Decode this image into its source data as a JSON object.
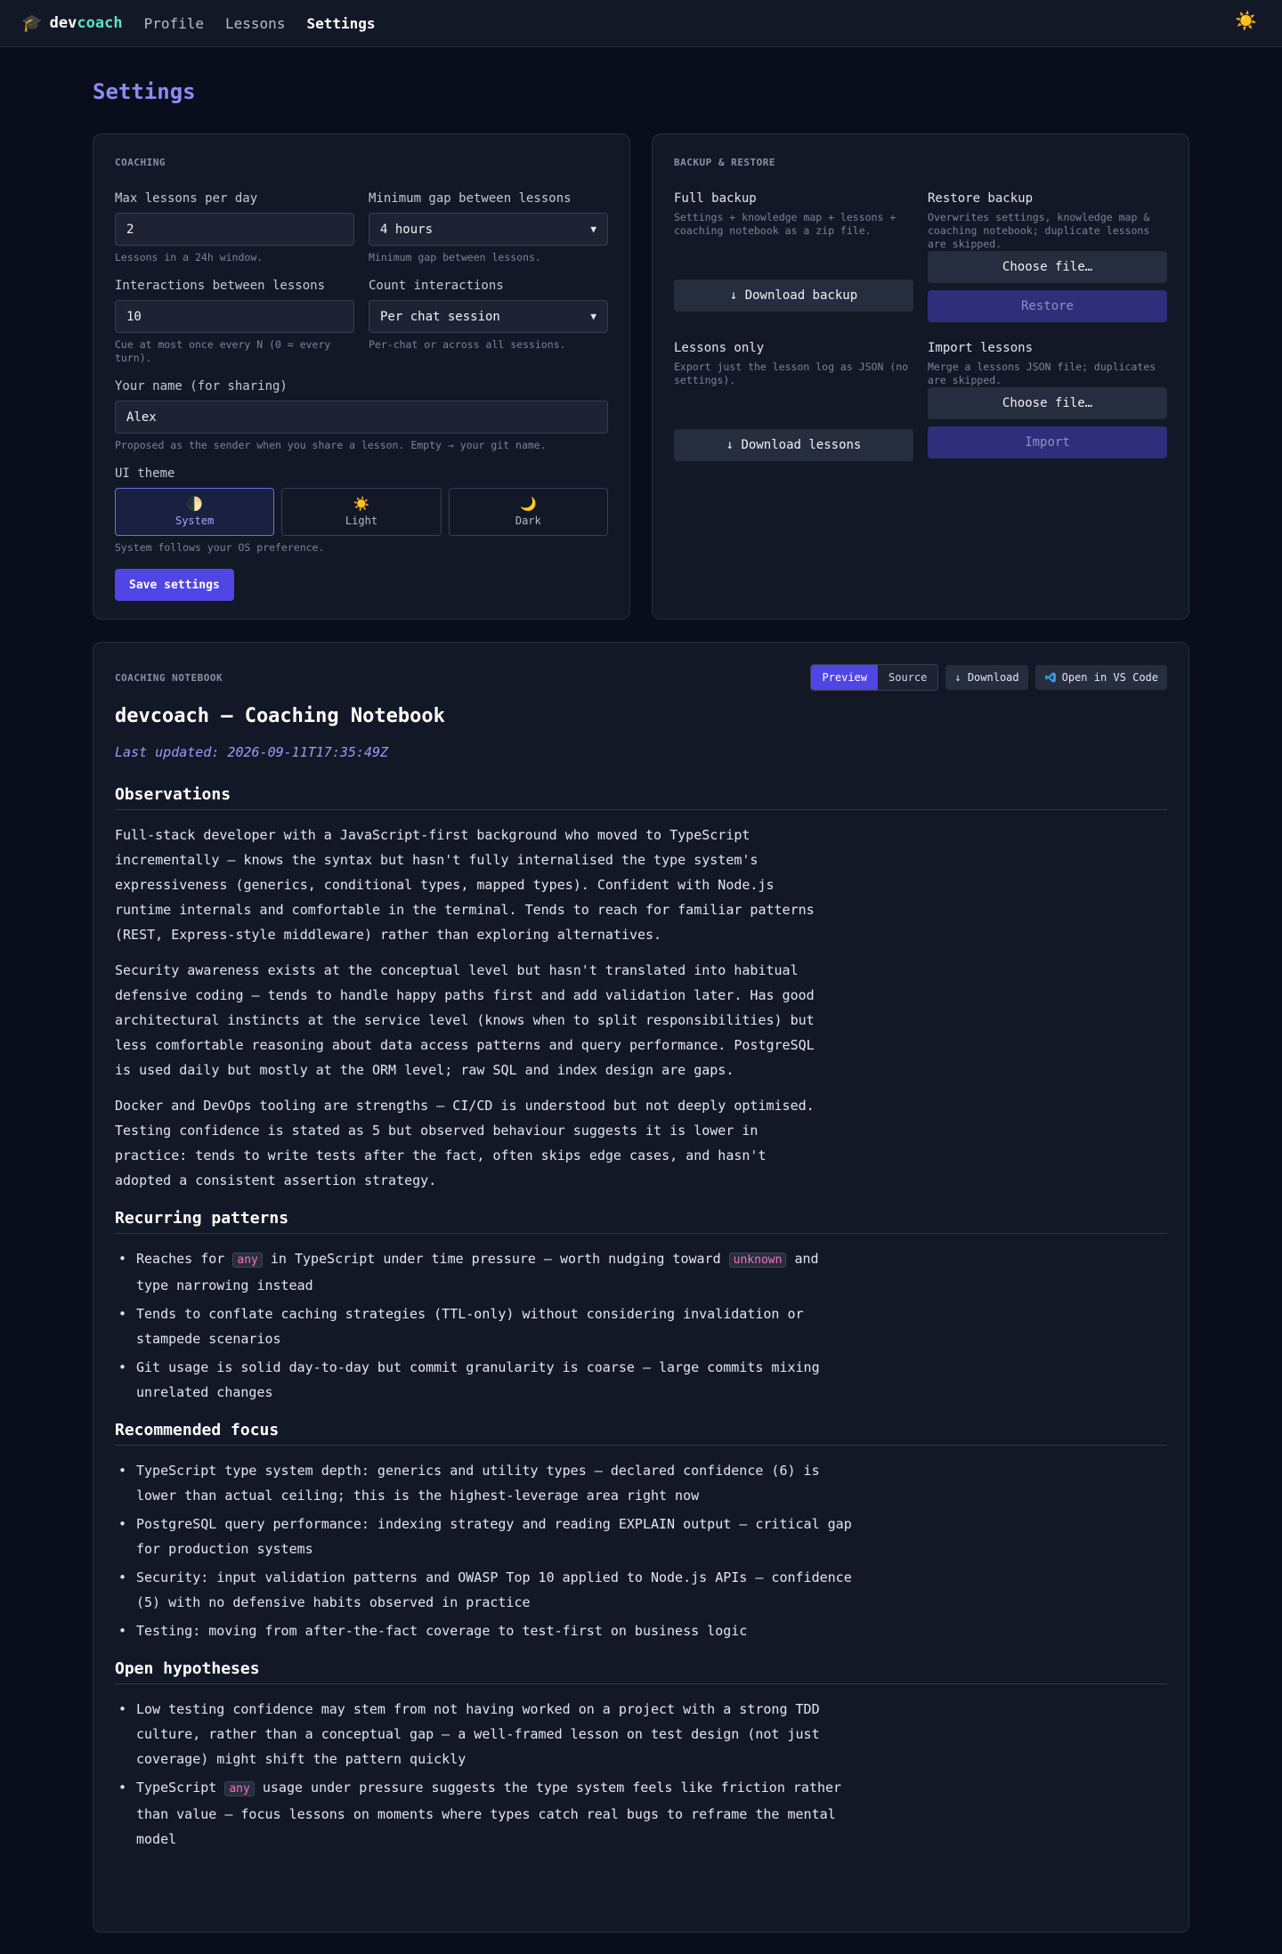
{
  "nav": {
    "brand_prefix": "dev",
    "brand_suffix": "coach",
    "links": [
      "Profile",
      "Lessons",
      "Settings"
    ],
    "active": "Settings"
  },
  "page": {
    "title": "Settings"
  },
  "coaching": {
    "label": "COACHING",
    "max_lessons": {
      "label": "Max lessons per day",
      "value": "2",
      "hint": "Lessons in a 24h window."
    },
    "min_gap": {
      "label": "Minimum gap between lessons",
      "value": "4 hours",
      "hint": "Minimum gap between lessons."
    },
    "interactions": {
      "label": "Interactions between lessons",
      "value": "10",
      "hint": "Cue at most once every N (0 = every turn)."
    },
    "count": {
      "label": "Count interactions",
      "value": "Per chat session",
      "hint": "Per-chat or across all sessions."
    },
    "name": {
      "label": "Your name (for sharing)",
      "value": "Alex",
      "hint": "Proposed as the sender when you share a lesson. Empty → your git name."
    },
    "theme": {
      "label": "UI theme",
      "options": [
        "System",
        "Light",
        "Dark"
      ],
      "selected": "System",
      "hint": "System follows your OS preference."
    },
    "save_label": "Save settings"
  },
  "backup": {
    "label": "BACKUP & RESTORE",
    "full": {
      "title": "Full backup",
      "desc": "Settings + knowledge map + lessons + coaching notebook as a zip file.",
      "button": "↓ Download backup"
    },
    "restore": {
      "title": "Restore backup",
      "desc": "Overwrites settings, knowledge map & coaching notebook; duplicate lessons are skipped.",
      "choose": "Choose file…",
      "button": "Restore"
    },
    "lessons": {
      "title": "Lessons only",
      "desc": "Export just the lesson log as JSON (no settings).",
      "button": "↓ Download lessons"
    },
    "import": {
      "title": "Import lessons",
      "desc": "Merge a lessons JSON file; duplicates are skipped.",
      "choose": "Choose file…",
      "button": "Import"
    }
  },
  "notebook": {
    "label": "COACHING NOTEBOOK",
    "tabs": [
      "Preview",
      "Source"
    ],
    "active_tab": "Preview",
    "download": "↓ Download",
    "vscode": "Open in VS Code",
    "title": "devcoach — Coaching Notebook",
    "updated": "Last updated: 2026-09-11T17:35:49Z",
    "observations": {
      "heading": "Observations",
      "paragraphs": [
        "Full-stack developer with a JavaScript-first background who moved to TypeScript incrementally — knows the syntax but hasn't fully internalised the type system's expressiveness (generics, conditional types, mapped types). Confident with Node.js runtime internals and comfortable in the terminal. Tends to reach for familiar patterns (REST, Express-style middleware) rather than exploring alternatives.",
        "Security awareness exists at the conceptual level but hasn't translated into habitual defensive coding — tends to handle happy paths first and add validation later. Has good architectural instincts at the service level (knows when to split responsibilities) but less comfortable reasoning about data access patterns and query performance. PostgreSQL is used daily but mostly at the ORM level; raw SQL and index design are gaps.",
        "Docker and DevOps tooling are strengths — CI/CD is understood but not deeply optimised. Testing confidence is stated as 5 but observed behaviour suggests it is lower in practice: tends to write tests after the fact, often skips edge cases, and hasn't adopted a consistent assertion strategy."
      ]
    },
    "patterns": {
      "heading": "Recurring patterns",
      "item1_a": "Reaches for ",
      "item1_code1": "any",
      "item1_b": " in TypeScript under time pressure — worth nudging toward ",
      "item1_code2": "unknown",
      "item1_c": " and type narrowing instead",
      "item2": "Tends to conflate caching strategies (TTL-only) without considering invalidation or stampede scenarios",
      "item3": "Git usage is solid day-to-day but commit granularity is coarse — large commits mixing unrelated changes"
    },
    "focus": {
      "heading": "Recommended focus",
      "items": [
        "TypeScript type system depth: generics and utility types — declared confidence (6) is lower than actual ceiling; this is the highest-leverage area right now",
        "PostgreSQL query performance: indexing strategy and reading EXPLAIN output — critical gap for production systems",
        "Security: input validation patterns and OWASP Top 10 applied to Node.js APIs — confidence (5) with no defensive habits observed in practice",
        "Testing: moving from after-the-fact coverage to test-first on business logic"
      ]
    },
    "hypotheses": {
      "heading": "Open hypotheses",
      "item1": "Low testing confidence may stem from not having worked on a project with a strong TDD culture, rather than a conceptual gap — a well-framed lesson on test design (not just coverage) might shift the pattern quickly",
      "item2_a": "TypeScript ",
      "item2_code": "any",
      "item2_b": " usage under pressure suggests the type system feels like friction rather than value — focus lessons on moments where types catch real bugs to reframe the mental model"
    }
  }
}
